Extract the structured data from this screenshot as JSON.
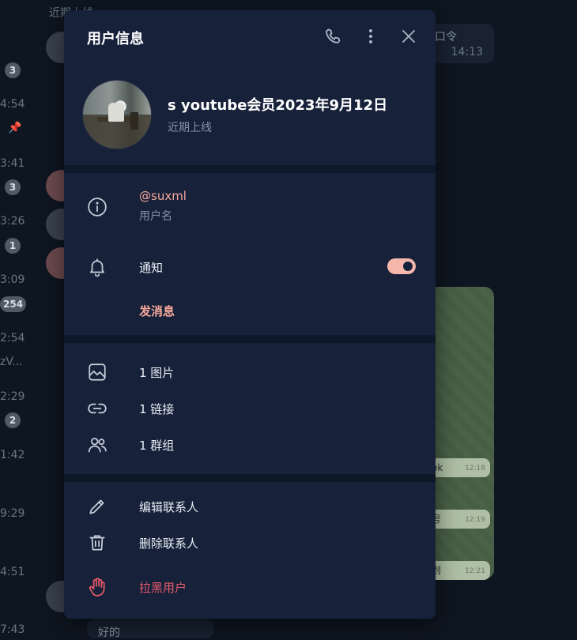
{
  "background": {
    "top_text": "近期上线",
    "times": [
      "4:54",
      "3:41",
      "3:26",
      "3:09",
      "2:54",
      "2:29",
      "1:42",
      "9:29",
      "4:51",
      "7:43"
    ],
    "badges": [
      "3",
      "3",
      "1",
      "254",
      "2"
    ],
    "snippet": "zV...",
    "top_bubble_text": "口令",
    "top_bubble_time": "14:13",
    "messages": [
      {
        "text": "ok",
        "time": "12:18"
      },
      {
        "text": "号",
        "time": "12:19"
      },
      {
        "text": "到",
        "time": "12:21"
      }
    ],
    "bottom_text": "好的"
  },
  "modal": {
    "title": "用户信息",
    "header_icons": [
      "phone-icon",
      "more-vertical-icon",
      "close-icon"
    ],
    "profile": {
      "name": "s youtube会员2023年9月12日",
      "status": "近期上线"
    },
    "info": {
      "username": "@suxml",
      "username_caption": "用户名",
      "notifications_label": "通知",
      "notifications_on": true,
      "send_message": "发消息"
    },
    "media": {
      "photos": "1 图片",
      "links": "1 链接",
      "groups": "1 群组"
    },
    "actions": {
      "edit": "编辑联系人",
      "delete": "删除联系人",
      "block": "拉黑用户"
    },
    "colors": {
      "panel": "#17213a",
      "accent": "#f5a89a",
      "danger": "#e85b6a"
    }
  }
}
